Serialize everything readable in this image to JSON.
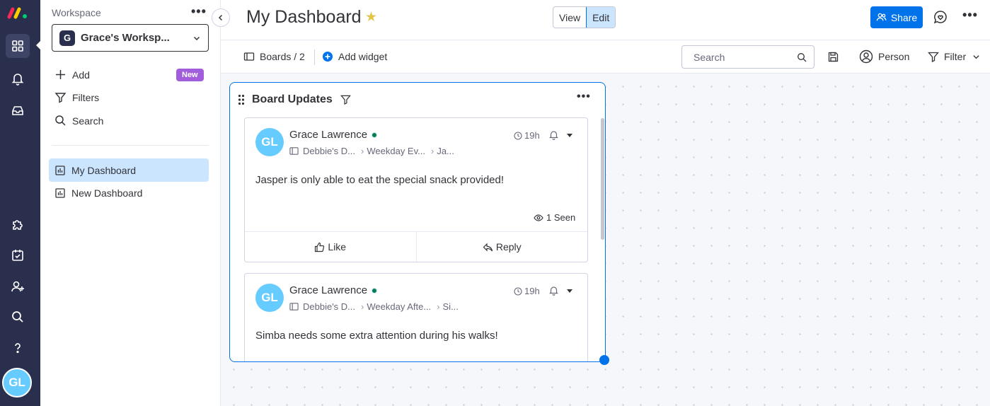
{
  "rail": {
    "avatar_initials": "GL",
    "icons": [
      "workspace-grid-icon",
      "bell-icon",
      "inbox-icon",
      "apps-puzzle-icon",
      "my-work-icon",
      "invite-member-icon",
      "search-icon",
      "help-icon"
    ]
  },
  "sidebar": {
    "workspace_label": "Workspace",
    "workspace_more": "•••",
    "workspace_badge": "G",
    "workspace_name": "Grace's Worksp...",
    "add_label": "Add",
    "new_badge": "New",
    "filters_label": "Filters",
    "search_label": "Search",
    "dashboards": [
      {
        "label": "My Dashboard",
        "active": true
      },
      {
        "label": "New Dashboard",
        "active": false
      }
    ]
  },
  "header": {
    "title": "My Dashboard",
    "view_label": "View",
    "edit_label": "Edit",
    "share_label": "Share",
    "more": "•••"
  },
  "toolbar": {
    "boards_label": "Boards / 2",
    "add_widget_label": "Add widget",
    "search_placeholder": "Search",
    "person_label": "Person",
    "filter_label": "Filter"
  },
  "widget": {
    "title": "Board Updates",
    "more": "•••",
    "updates": [
      {
        "avatar": "GL",
        "author": "Grace Lawrence",
        "crumb1": "Debbie's D...",
        "crumb2": "Weekday Ev...",
        "crumb3": "Ja...",
        "time": "19h",
        "text": "Jasper is only able to eat the special snack provided!",
        "seen": "1 Seen",
        "like_label": "Like",
        "reply_label": "Reply"
      },
      {
        "avatar": "GL",
        "author": "Grace Lawrence",
        "crumb1": "Debbie's D...",
        "crumb2": "Weekday Afte...",
        "crumb3": "Si...",
        "time": "19h",
        "text": "Simba needs some extra attention during his walks!"
      }
    ]
  },
  "colors": {
    "rail_bg": "#292f4c",
    "primary": "#0073ea",
    "selected": "#cce5ff",
    "new_badge": "#a25ddc",
    "avatar": "#66ccff",
    "online": "#037f4c",
    "star": "#e2c54b"
  }
}
